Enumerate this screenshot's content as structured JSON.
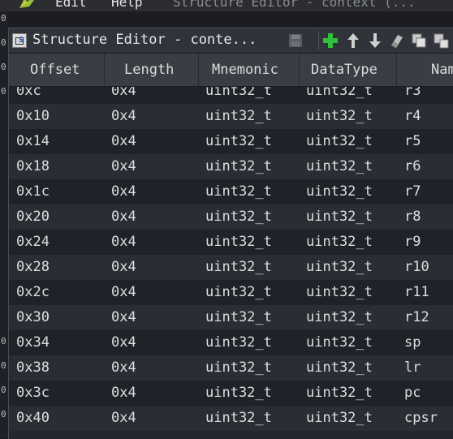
{
  "menubar": {
    "items": [
      "Edit",
      "Help"
    ],
    "window_title": "Structure Editor - context (..."
  },
  "gutter": {
    "glyph": "0"
  },
  "window": {
    "title": "Structure Editor - conte..."
  },
  "toolbar": {
    "icons": [
      "save-icon",
      "add-icon",
      "move-up-icon",
      "move-down-icon",
      "clear-icon",
      "copy-icon",
      "paste-icon"
    ]
  },
  "table": {
    "columns": [
      "Offset",
      "Length",
      "Mnemonic",
      "DataType",
      "Name"
    ],
    "rows": [
      {
        "offset": "0xc",
        "length": "0x4",
        "mnemonic": "uint32_t",
        "datatype": "uint32_t",
        "name": "r3"
      },
      {
        "offset": "0x10",
        "length": "0x4",
        "mnemonic": "uint32_t",
        "datatype": "uint32_t",
        "name": "r4"
      },
      {
        "offset": "0x14",
        "length": "0x4",
        "mnemonic": "uint32_t",
        "datatype": "uint32_t",
        "name": "r5"
      },
      {
        "offset": "0x18",
        "length": "0x4",
        "mnemonic": "uint32_t",
        "datatype": "uint32_t",
        "name": "r6"
      },
      {
        "offset": "0x1c",
        "length": "0x4",
        "mnemonic": "uint32_t",
        "datatype": "uint32_t",
        "name": "r7"
      },
      {
        "offset": "0x20",
        "length": "0x4",
        "mnemonic": "uint32_t",
        "datatype": "uint32_t",
        "name": "r8"
      },
      {
        "offset": "0x24",
        "length": "0x4",
        "mnemonic": "uint32_t",
        "datatype": "uint32_t",
        "name": "r9"
      },
      {
        "offset": "0x28",
        "length": "0x4",
        "mnemonic": "uint32_t",
        "datatype": "uint32_t",
        "name": "r10"
      },
      {
        "offset": "0x2c",
        "length": "0x4",
        "mnemonic": "uint32_t",
        "datatype": "uint32_t",
        "name": "r11"
      },
      {
        "offset": "0x30",
        "length": "0x4",
        "mnemonic": "uint32_t",
        "datatype": "uint32_t",
        "name": "r12"
      },
      {
        "offset": "0x34",
        "length": "0x4",
        "mnemonic": "uint32_t",
        "datatype": "uint32_t",
        "name": "sp"
      },
      {
        "offset": "0x38",
        "length": "0x4",
        "mnemonic": "uint32_t",
        "datatype": "uint32_t",
        "name": "lr"
      },
      {
        "offset": "0x3c",
        "length": "0x4",
        "mnemonic": "uint32_t",
        "datatype": "uint32_t",
        "name": "pc"
      },
      {
        "offset": "0x40",
        "length": "0x4",
        "mnemonic": "uint32_t",
        "datatype": "uint32_t",
        "name": "cpsr"
      }
    ]
  },
  "colors": {
    "accent_add": "#2fbf3a",
    "row_odd": "#2a2d34",
    "row_even": "#1f2228"
  }
}
